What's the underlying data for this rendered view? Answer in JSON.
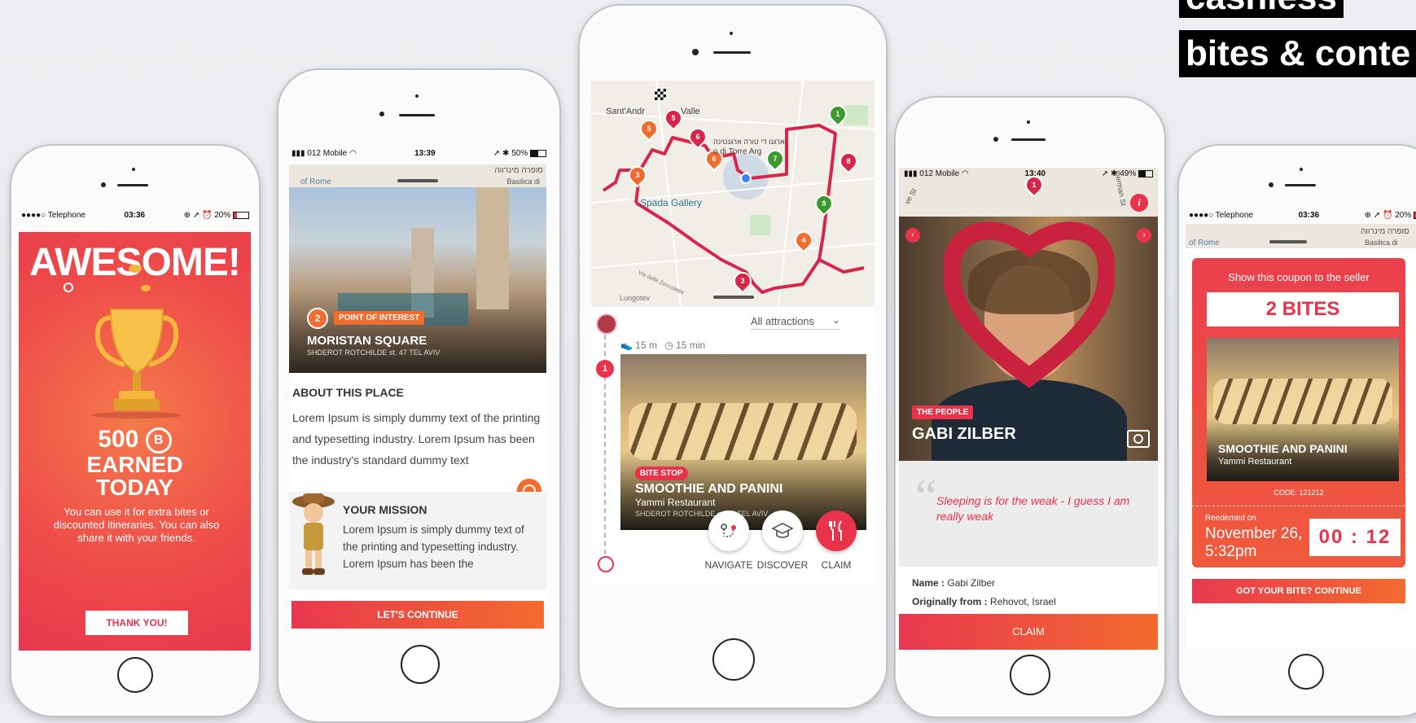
{
  "headline": {
    "line1": "cashless",
    "line2": "bites & conte"
  },
  "colors": {
    "accent": "#e8334a",
    "orange": "#f36b2d",
    "gold": "#f6b73c"
  },
  "phone1": {
    "status": {
      "carrier": "●●●●○ Telephone",
      "time": "03:36",
      "battery": "20%"
    },
    "title": "AWESOME!",
    "points": "500",
    "coin": "B",
    "earned": "EARNED",
    "today": "TODAY",
    "body": "You can use it for extra bites or discounted itineraries. You can also share it with your friends.",
    "button": "THANK YOU!"
  },
  "phone2": {
    "status": {
      "carrier": "012 Mobile",
      "time": "13:39",
      "battery": "50%"
    },
    "map_label_he": "סופרה מינרווה",
    "map_label_2": "Basilica di",
    "map_label_3": "of Rome",
    "poi_number": "2",
    "poi_tag": "POINT OF INTEREST",
    "poi_name": "MORISTAN SQUARE",
    "poi_address": "SHDEROT ROTCHILDE st. 47 TEL AVIV",
    "about_title": "ABOUT THIS PLACE",
    "about_text": "Lorem Ipsum is simply dummy text of the printing and typesetting industry. Lorem Ipsum has been the industry's standard dummy text",
    "mission_title": "YOUR MISSION",
    "mission_text": "Lorem Ipsum is simply dummy text of the printing and typesetting industry. Lorem Ipsum has been the",
    "button": "LET'S CONTINUE"
  },
  "phone3": {
    "map_labels": [
      "Sant'Andr",
      "Valle",
      "Spada Gallery",
      "ארגנו די טורה ארגנטינה",
      "o di Torre Arg",
      "Via delle Zoccolette",
      "Lungotev"
    ],
    "filter": "All attractions",
    "walk": "15 m",
    "time": "15 min",
    "step_number": "1",
    "tag": "BITE STOP",
    "title": "SMOOTHIE AND PANINI",
    "subtitle": "Yammi Restaurant",
    "address": "SHDEROT ROTCHILDE st. 47 TEL AVIV",
    "actions": [
      {
        "label": "NAVIGATE",
        "icon": "navigate-icon"
      },
      {
        "label": "DISCOVER",
        "icon": "graduation-cap-icon"
      },
      {
        "label": "CLAIM",
        "icon": "fork-knife-icon"
      }
    ]
  },
  "phone4": {
    "status": {
      "carrier": "012 Mobile",
      "time": "13:40",
      "battery": "49%"
    },
    "map_labels": [
      "Iberman St",
      "ve St"
    ],
    "tag": "THE PEOPLE",
    "name_title": "GABI ZILBER",
    "quote": "Sleeping is for the weak - I guess I am really weak",
    "name_label": "Name :",
    "name_value": "Gabi Zilber",
    "origin_label": "Originally from :",
    "origin_value": "Rehovot, Israel",
    "button": "CLAIM"
  },
  "phone5": {
    "status": {
      "carrier": "●●●●○ Telephone",
      "time": "03:36",
      "battery": "20%"
    },
    "map_label_he": "סופרה מינרווה",
    "map_label_2": "Basilica di",
    "map_label_3": "of Rome",
    "coupon_hint": "Show this coupon to the seller",
    "bites": "2 BITES",
    "title": "SMOOTHIE AND PANINI",
    "subtitle": "Yammi Restaurant",
    "code": "CODE: 121212",
    "redeemed_label": "Reedemed on",
    "redeemed_date": "November 26,",
    "redeemed_time": "5:32pm",
    "timer": "00 : 12",
    "button": "GOT YOUR BITE? CONTINUE"
  }
}
